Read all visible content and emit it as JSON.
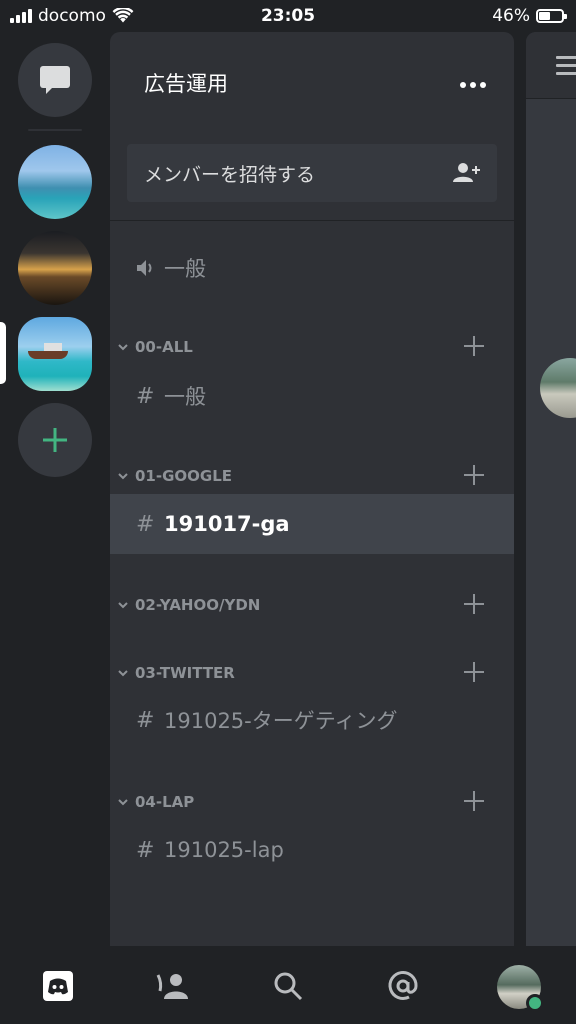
{
  "status_bar": {
    "carrier": "docomo",
    "time": "23:05",
    "battery_percent": "46%",
    "battery_level": 0.46
  },
  "rail": {
    "servers": [
      {
        "name": "server-beach",
        "selected": false
      },
      {
        "name": "server-sunset",
        "selected": false
      },
      {
        "name": "server-boat",
        "selected": true
      }
    ]
  },
  "guild": {
    "name": "広告運用",
    "invite_label": "メンバーを招待する"
  },
  "channels": {
    "voice_general": "一般",
    "categories": [
      {
        "name": "00-ALL",
        "channels": [
          "一般"
        ]
      },
      {
        "name": "01-GOOGLE",
        "channels": [
          "191017-ga"
        ],
        "active": "191017-ga"
      },
      {
        "name": "02-YAHOO/YDN",
        "channels": []
      },
      {
        "name": "03-TWITTER",
        "channels": [
          "191025-ターゲティング"
        ]
      },
      {
        "name": "04-LAP",
        "channels": [
          "191025-lap"
        ]
      }
    ]
  },
  "tabbar": {
    "icons": [
      "discord-home-icon",
      "friends-icon",
      "search-icon",
      "mentions-icon",
      "profile-avatar"
    ]
  },
  "colors": {
    "rail_bg": "#202225",
    "panel_bg": "#2f3136",
    "active_channel_bg": "#40444b",
    "muted_text": "#8e9297",
    "accent_green": "#43b581"
  }
}
